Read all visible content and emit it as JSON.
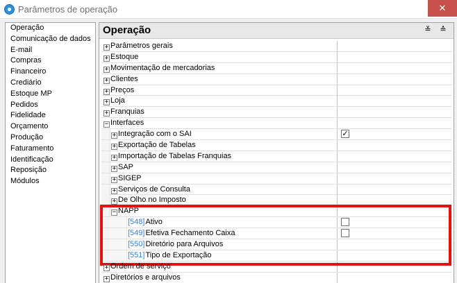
{
  "window": {
    "title": "Parâmetros de operação",
    "close_glyph": "✕"
  },
  "sidebar": {
    "items": [
      {
        "label": "Operação"
      },
      {
        "label": "Comunicação de dados"
      },
      {
        "label": "E-mail"
      },
      {
        "label": "Compras"
      },
      {
        "label": "Financeiro"
      },
      {
        "label": "Crediário"
      },
      {
        "label": "Estoque MP"
      },
      {
        "label": "Pedidos"
      },
      {
        "label": "Fidelidade"
      },
      {
        "label": "Orçamento"
      },
      {
        "label": "Produção"
      },
      {
        "label": "Faturamento"
      },
      {
        "label": "Identificação"
      },
      {
        "label": "Reposição"
      },
      {
        "label": "Módulos"
      }
    ]
  },
  "section": {
    "title": "Operação",
    "collapse_glyph": "≚",
    "expand_glyph": "≙"
  },
  "tree": {
    "rows": [
      {
        "label": "Parâmetros gerais",
        "toggle": "+"
      },
      {
        "label": "Estoque",
        "toggle": "+"
      },
      {
        "label": "Movimentação de mercadorias",
        "toggle": "+"
      },
      {
        "label": "Clientes",
        "toggle": "+"
      },
      {
        "label": "Preços",
        "toggle": "+"
      },
      {
        "label": "Loja",
        "toggle": "+"
      },
      {
        "label": "Franquias",
        "toggle": "+"
      },
      {
        "label": "Interfaces",
        "toggle": "−"
      },
      {
        "label": "Integração com o SAI",
        "toggle": "+",
        "check": "✓"
      },
      {
        "label": "Exportação de Tabelas",
        "toggle": "+"
      },
      {
        "label": "Importação de Tabelas Franquias",
        "toggle": "+"
      },
      {
        "label": "SAP",
        "toggle": "+"
      },
      {
        "label": "SIGEP",
        "toggle": "+"
      },
      {
        "label": "Serviços de Consulta",
        "toggle": "+"
      },
      {
        "label": "De Olho no Imposto",
        "toggle": "+"
      },
      {
        "label": "NAPP",
        "toggle": "−"
      },
      {
        "code": "[548]",
        "label": "Ativo",
        "check": ""
      },
      {
        "code": "[549]",
        "label": "Efetiva Fechamento Caixa",
        "check": ""
      },
      {
        "code": "[550]",
        "label": "Diretório para Arquivos"
      },
      {
        "code": "[551]",
        "label": "Tipo de Exportação"
      },
      {
        "label": "Ordem de serviço",
        "toggle": "+"
      },
      {
        "label": "Diretórios e arquivos",
        "toggle": "+"
      }
    ]
  }
}
